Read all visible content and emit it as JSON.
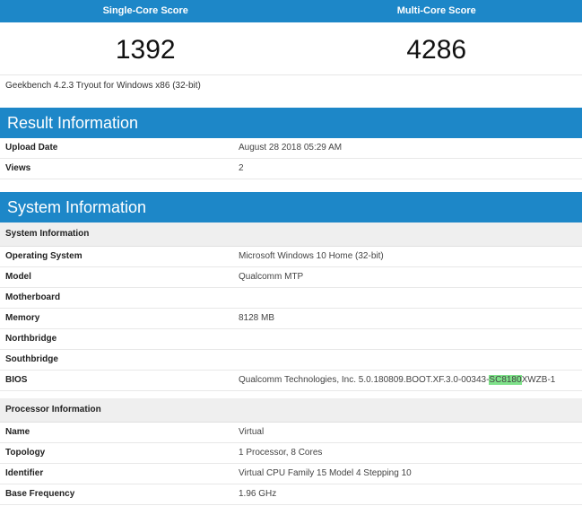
{
  "scores": {
    "single_label": "Single-Core Score",
    "single_value": "1392",
    "multi_label": "Multi-Core Score",
    "multi_value": "4286"
  },
  "version_text": "Geekbench 4.2.3 Tryout for Windows x86 (32-bit)",
  "result": {
    "title": "Result Information",
    "rows": [
      {
        "key": "Upload Date",
        "value": "August 28 2018 05:29 AM"
      },
      {
        "key": "Views",
        "value": "2"
      }
    ]
  },
  "system": {
    "title": "System Information",
    "subhead": "System Information",
    "rows": [
      {
        "key": "Operating System",
        "value": "Microsoft Windows 10 Home (32-bit)"
      },
      {
        "key": "Model",
        "value": "Qualcomm MTP"
      },
      {
        "key": "Motherboard",
        "value": ""
      },
      {
        "key": "Memory",
        "value": "8128 MB"
      },
      {
        "key": "Northbridge",
        "value": ""
      },
      {
        "key": "Southbridge",
        "value": ""
      }
    ],
    "bios": {
      "key": "BIOS",
      "value_pre": "Qualcomm Technologies, Inc. 5.0.180809.BOOT.XF.3.0-00343-",
      "value_highlight": "SC8180",
      "value_post": "XWZB-1"
    }
  },
  "processor": {
    "subhead": "Processor Information",
    "rows": [
      {
        "key": "Name",
        "value": "Virtual"
      },
      {
        "key": "Topology",
        "value": "1 Processor, 8 Cores"
      },
      {
        "key": "Identifier",
        "value": "Virtual CPU Family 15 Model 4 Stepping 10"
      },
      {
        "key": "Base Frequency",
        "value": "1.96 GHz"
      }
    ]
  },
  "colors": {
    "banner": "#1d87c8",
    "highlight": "#7fe28a"
  }
}
